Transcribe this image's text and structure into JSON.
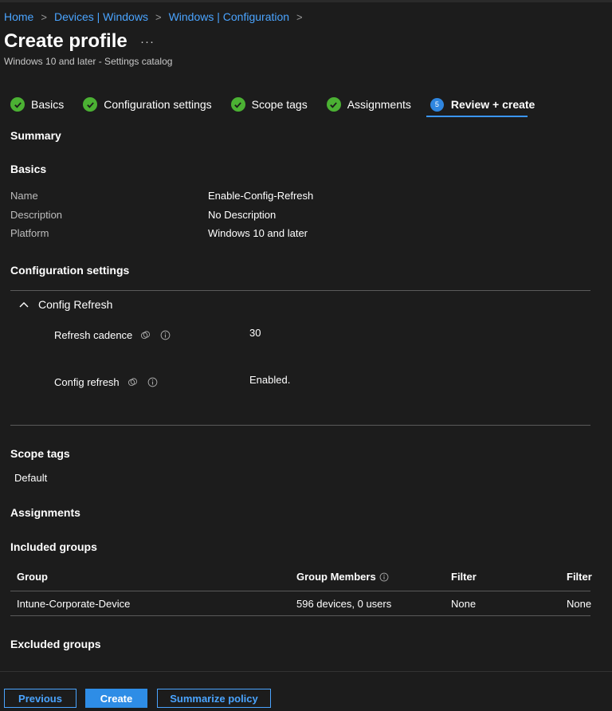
{
  "breadcrumb": [
    "Home",
    "Devices | Windows",
    "Windows | Configuration"
  ],
  "header": {
    "title": "Create profile",
    "more": "···",
    "subtitle": "Windows 10 and later - Settings catalog"
  },
  "steps": [
    {
      "label": "Basics",
      "state": "done"
    },
    {
      "label": "Configuration settings",
      "state": "done"
    },
    {
      "label": "Scope tags",
      "state": "done"
    },
    {
      "label": "Assignments",
      "state": "done"
    },
    {
      "label": "Review + create",
      "state": "active",
      "number": "5"
    }
  ],
  "summary": {
    "title": "Summary"
  },
  "basics": {
    "title": "Basics",
    "rows": [
      {
        "label": "Name",
        "value": "Enable-Config-Refresh"
      },
      {
        "label": "Description",
        "value": "No Description"
      },
      {
        "label": "Platform",
        "value": "Windows 10 and later"
      }
    ]
  },
  "configuration": {
    "title": "Configuration settings",
    "group": "Config Refresh",
    "settings": [
      {
        "name": "Refresh cadence",
        "value": "30"
      },
      {
        "name": "Config refresh",
        "value": "Enabled."
      }
    ]
  },
  "scope_tags": {
    "title": "Scope tags",
    "value": "Default"
  },
  "assignments": {
    "title": "Assignments",
    "included_title": "Included groups",
    "columns": [
      "Group",
      "Group Members",
      "Filter",
      "Filter"
    ],
    "rows": [
      {
        "group": "Intune-Corporate-Device",
        "members": "596 devices, 0 users",
        "filter": "None",
        "filter2": "None"
      }
    ],
    "excluded_title": "Excluded groups"
  },
  "buttons": {
    "previous": "Previous",
    "create": "Create",
    "summarize": "Summarize policy"
  },
  "colors": {
    "accent": "#4aa4ff",
    "success": "#4bb133",
    "primary_button": "#2e8de6",
    "background": "#1c1c1c"
  }
}
